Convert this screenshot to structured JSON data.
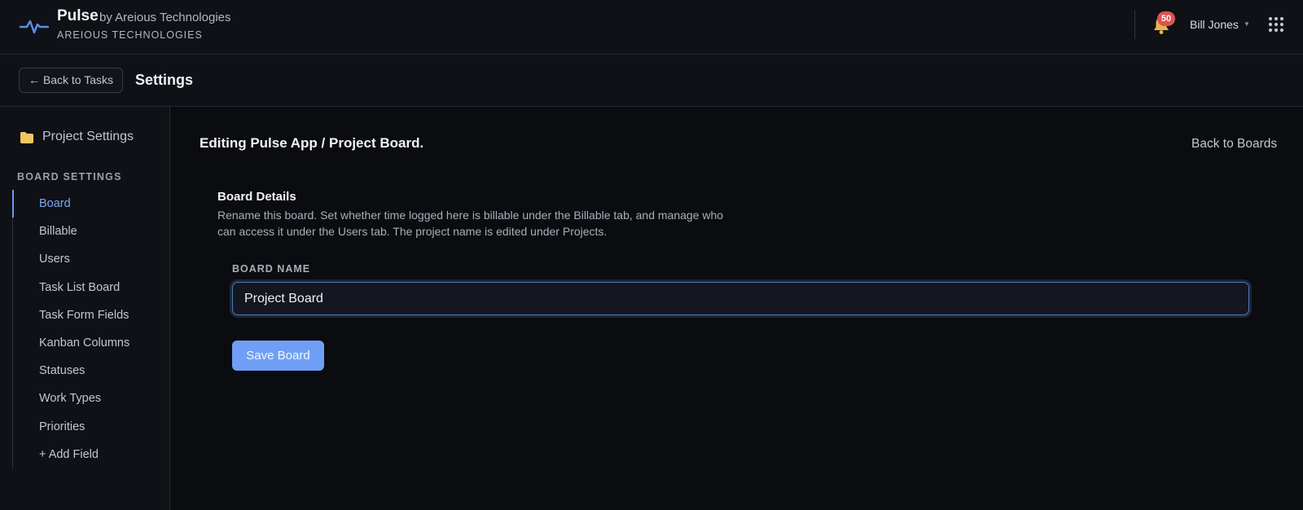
{
  "header": {
    "brand_name": "Pulse",
    "brand_by": "by Areious Technologies",
    "brand_org": "AREIOUS TECHNOLOGIES",
    "notification_count": "50",
    "user_name": "Bill Jones",
    "icons": {
      "logo": "pulse-wave-icon",
      "notifications": "bell-icon",
      "user_menu": "caret-down-icon",
      "apps": "grid-icon"
    }
  },
  "subheader": {
    "back_label": "← Back to Tasks",
    "title": "Settings"
  },
  "sidebar": {
    "project_settings_label": "Project Settings",
    "section_label": "BOARD SETTINGS",
    "items": [
      {
        "label": "Board",
        "active": true
      },
      {
        "label": "Billable",
        "active": false
      },
      {
        "label": "Users",
        "active": false
      },
      {
        "label": "Task List Board",
        "active": false
      },
      {
        "label": "Task Form Fields",
        "active": false
      },
      {
        "label": "Kanban Columns",
        "active": false
      },
      {
        "label": "Statuses",
        "active": false
      },
      {
        "label": "Work Types",
        "active": false
      },
      {
        "label": "Priorities",
        "active": false
      },
      {
        "label": "+ Add Field",
        "active": false
      }
    ]
  },
  "main": {
    "editing_title": "Editing Pulse App / Project Board.",
    "back_to_boards": "Back to Boards",
    "details_title": "Board Details",
    "details_description": "Rename this board. Set whether time logged here is billable under the Billable tab, and manage who can access it under the Users tab. The project name is edited under Projects.",
    "field_label": "BOARD NAME",
    "board_name_value": "Project Board",
    "save_label": "Save Board"
  },
  "colors": {
    "background": "#0b0c10",
    "panel": "#0f1116",
    "accent": "#6e9ff4",
    "badge": "#e0524f",
    "folder": "#f0c860"
  }
}
